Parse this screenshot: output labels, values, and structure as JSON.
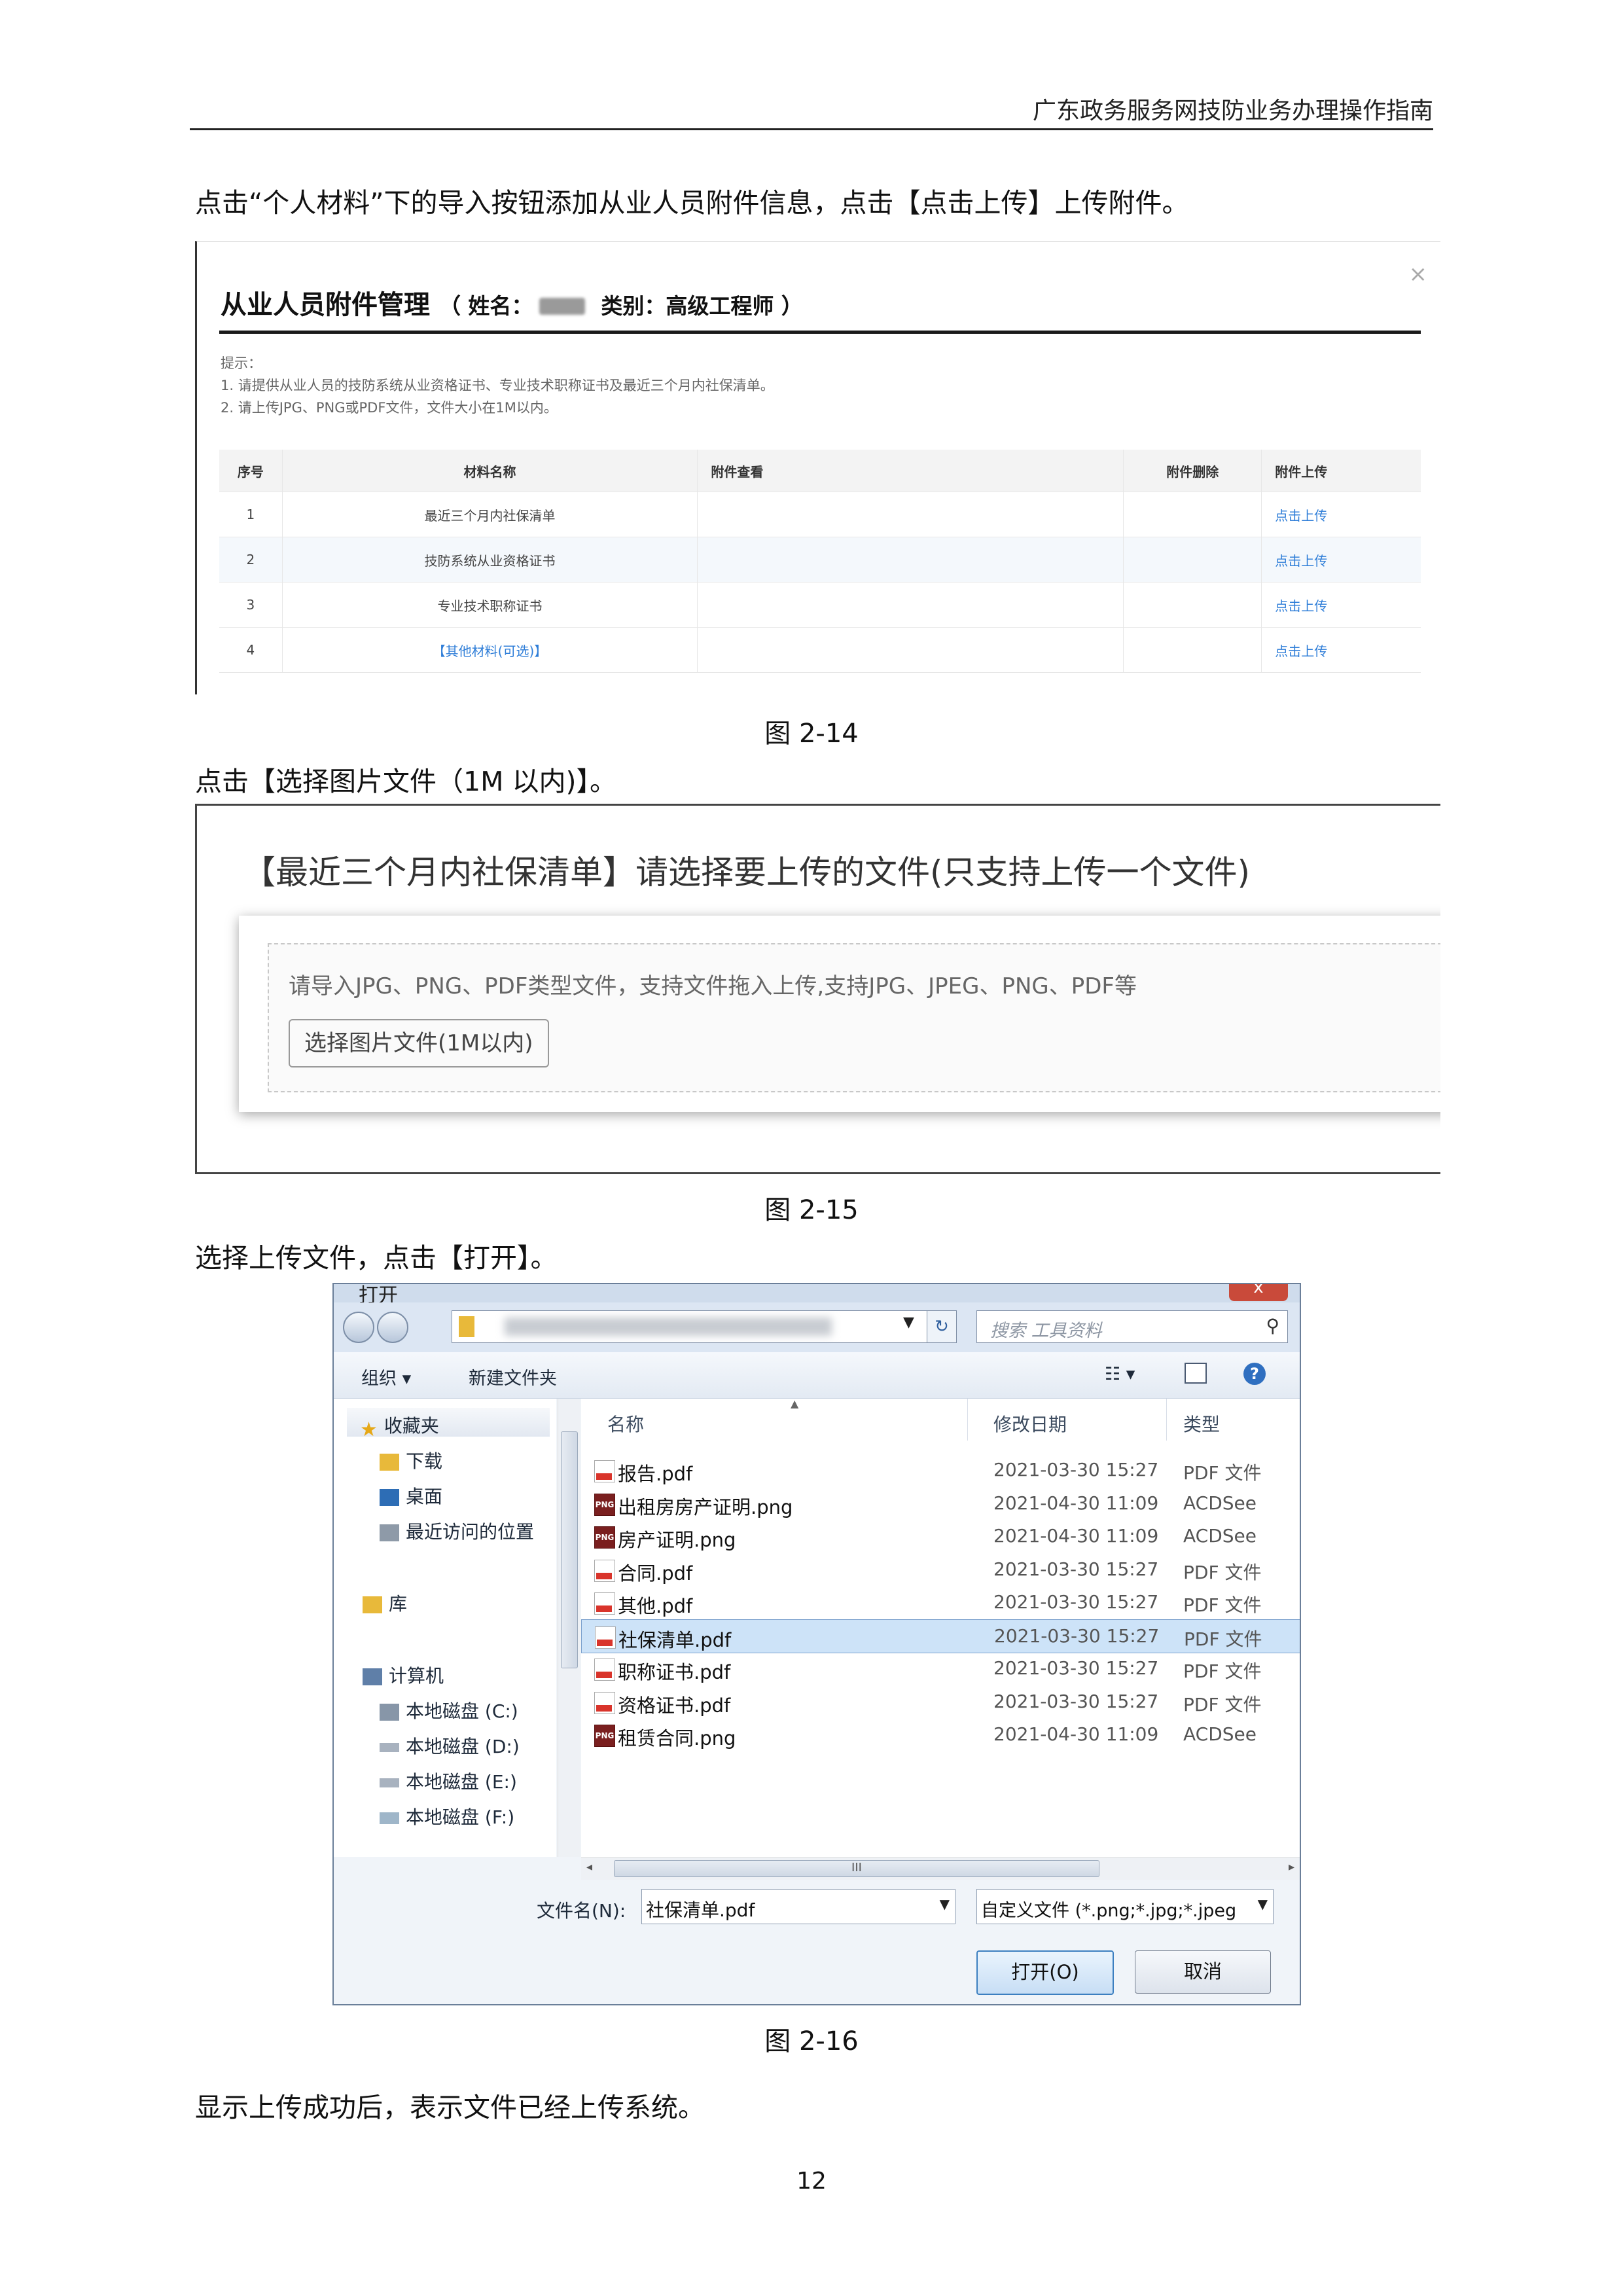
{
  "header": {
    "doc_title": "广东政务服务网技防业务办理操作指南"
  },
  "paragraphs": {
    "p1": "点击“个人材料”下的导入按钮添加从业人员附件信息，点击【点击上传】上传附件。",
    "p2": "点击【选择图片文件（1M 以内)】。",
    "p3": "选择上传文件，点击【打开】。",
    "p4": "显示上传成功后，表示文件已经上传系统。"
  },
  "captions": {
    "fig14": "图 2-14",
    "fig15": "图 2-15",
    "fig16": "图 2-16"
  },
  "page_number": "12",
  "fig14": {
    "close_icon": "×",
    "title": "从业人员附件管理",
    "name_label": "（ 姓名：",
    "category_label": "类别：高级工程师 ）",
    "tips": [
      "提示：",
      "1. 请提供从业人员的技防系统从业资格证书、专业技术职称证书及最近三个月内社保清单。",
      "2. 请上传JPG、PNG或PDF文件，文件大小在1M以内。"
    ],
    "columns": [
      "序号",
      "材料名称",
      "附件查看",
      "附件删除",
      "附件上传"
    ],
    "rows": [
      {
        "no": "1",
        "name": "最近三个月内社保清单",
        "upload": "点击上传"
      },
      {
        "no": "2",
        "name": "技防系统从业资格证书",
        "upload": "点击上传"
      },
      {
        "no": "3",
        "name": "专业技术职称证书",
        "upload": "点击上传"
      },
      {
        "no": "4",
        "name": "【其他材料(可选)】",
        "upload": "点击上传"
      }
    ],
    "link_color": "#2f7ed8"
  },
  "fig15": {
    "heading": "【最近三个月内社保清单】请选择要上传的文件(只支持上传一个文件)",
    "hint": "请导入JPG、PNG、PDF类型文件，支持文件拖入上传,支持JPG、JPEG、PNG、PDF等",
    "choose_button": "选择图片文件(1M以内)"
  },
  "fig16": {
    "window_title": "打开",
    "close_icon": "x",
    "search_placeholder": "搜索 工具资料",
    "toolbar": {
      "organize": "组织 ▾",
      "new_folder": "新建文件夹"
    },
    "nav": {
      "favorites": "收藏夹",
      "downloads": "下载",
      "desktop": "桌面",
      "recent": "最近访问的位置",
      "library": "库",
      "computer": "计算机",
      "drive_c": "本地磁盘 (C:)",
      "drive_d": "本地磁盘 (D:)",
      "drive_e": "本地磁盘 (E:)",
      "drive_f": "本地磁盘 (F:)"
    },
    "columns": {
      "name": "名称",
      "date": "修改日期",
      "type": "类型"
    },
    "files": [
      {
        "name": "报告.pdf",
        "date": "2021-03-30 15:27",
        "type": "PDF 文件",
        "icon": "pdf-file-icon"
      },
      {
        "name": "出租房房产证明.png",
        "date": "2021-04-30 11:09",
        "type": "ACDSee",
        "icon": "png-file-icon"
      },
      {
        "name": "房产证明.png",
        "date": "2021-04-30 11:09",
        "type": "ACDSee",
        "icon": "png-file-icon"
      },
      {
        "name": "合同.pdf",
        "date": "2021-03-30 15:27",
        "type": "PDF 文件",
        "icon": "pdf-file-icon"
      },
      {
        "name": "其他.pdf",
        "date": "2021-03-30 15:27",
        "type": "PDF 文件",
        "icon": "pdf-file-icon"
      },
      {
        "name": "社保清单.pdf",
        "date": "2021-03-30 15:27",
        "type": "PDF 文件",
        "icon": "pdf-file-icon",
        "selected": true
      },
      {
        "name": "职称证书.pdf",
        "date": "2021-03-30 15:27",
        "type": "PDF 文件",
        "icon": "pdf-file-icon"
      },
      {
        "name": "资格证书.pdf",
        "date": "2021-03-30 15:27",
        "type": "PDF 文件",
        "icon": "pdf-file-icon"
      },
      {
        "name": "租赁合同.png",
        "date": "2021-04-30 11:09",
        "type": "ACDSee",
        "icon": "png-file-icon"
      }
    ],
    "hscroll_label": "III",
    "filename_label": "文件名(N):",
    "filename_value": "社保清单.pdf",
    "filter_value": "自定义文件 (*.png;*.jpg;*.jpeg",
    "open_button": "打开(O)",
    "cancel_button": "取消"
  }
}
